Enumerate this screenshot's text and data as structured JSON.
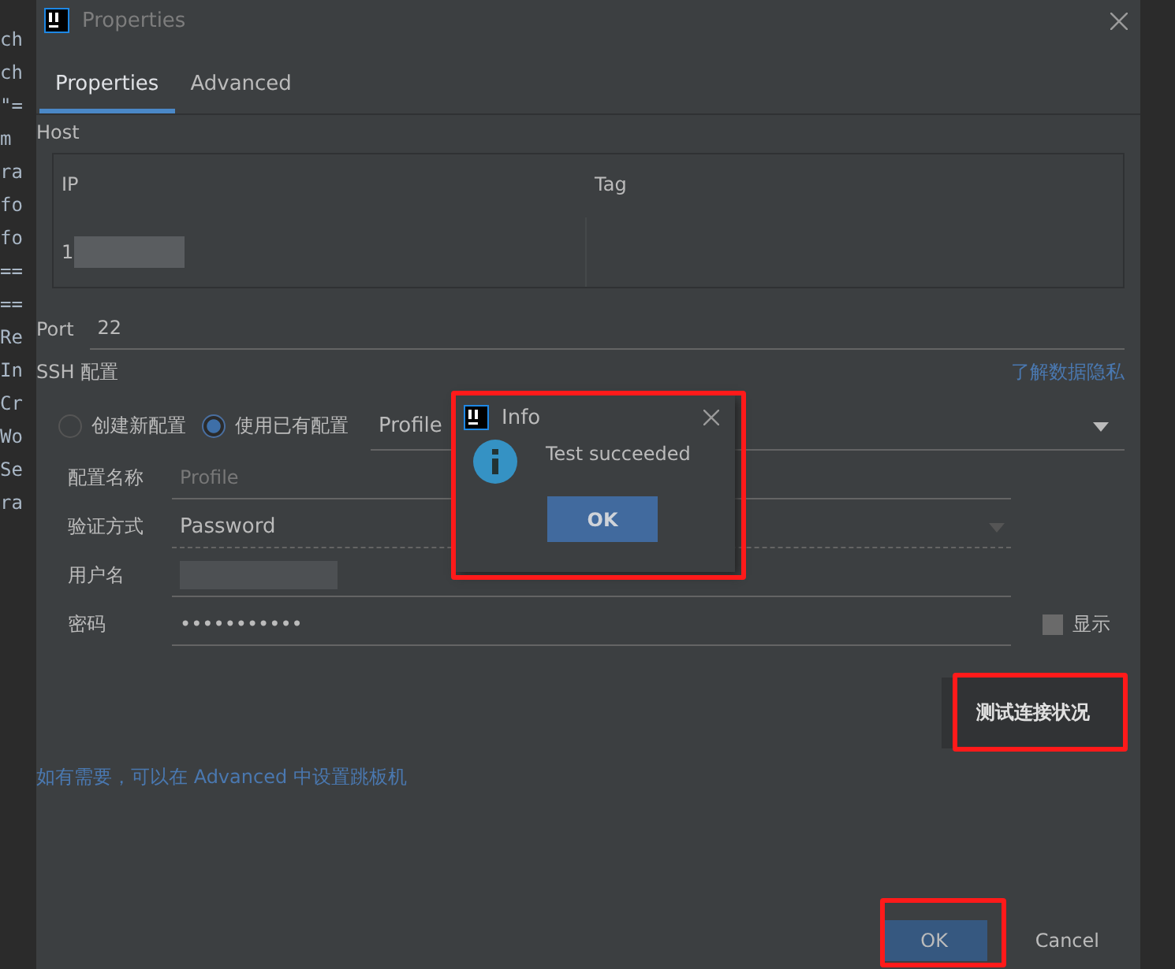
{
  "editor_fragments": [
    "ch",
    "ch",
    "\"=",
    "m",
    "ra",
    "fo",
    "fo",
    "==",
    "==",
    "Re",
    "In",
    "Cr",
    "Wo",
    "Se",
    "ra"
  ],
  "window": {
    "title": "Properties"
  },
  "tabs": [
    {
      "label": "Properties",
      "selected": true
    },
    {
      "label": "Advanced",
      "selected": false
    }
  ],
  "host": {
    "label": "Host",
    "table": {
      "columns": [
        "IP",
        "Tag"
      ],
      "rows": [
        [
          "1",
          ""
        ]
      ]
    }
  },
  "port": {
    "label": "Port",
    "value": "22"
  },
  "ssh": {
    "label": "SSH 配置",
    "privacy_link": "了解数据隐私",
    "options": [
      {
        "label": "创建新配置",
        "selected": false
      },
      {
        "label": "使用已有配置",
        "selected": true
      }
    ],
    "profile_select": "Profile",
    "fields": [
      {
        "kind": "text",
        "label": "配置名称",
        "placeholder": "Profile"
      },
      {
        "kind": "select",
        "label": "验证方式",
        "value": "Password"
      },
      {
        "kind": "masked",
        "label": "用户名"
      },
      {
        "kind": "password",
        "label": "密码",
        "value": "•••••••••••",
        "show": {
          "label": "显示",
          "checked": false
        }
      }
    ],
    "test_button": "测试连接状况"
  },
  "hint": "如有需要，可以在 Advanced 中设置跳板机",
  "buttons": [
    {
      "label": "OK",
      "primary": true
    },
    {
      "label": "Cancel",
      "primary": false
    }
  ],
  "info_dialog": {
    "title": "Info",
    "message": "Test succeeded",
    "button": "OK"
  }
}
